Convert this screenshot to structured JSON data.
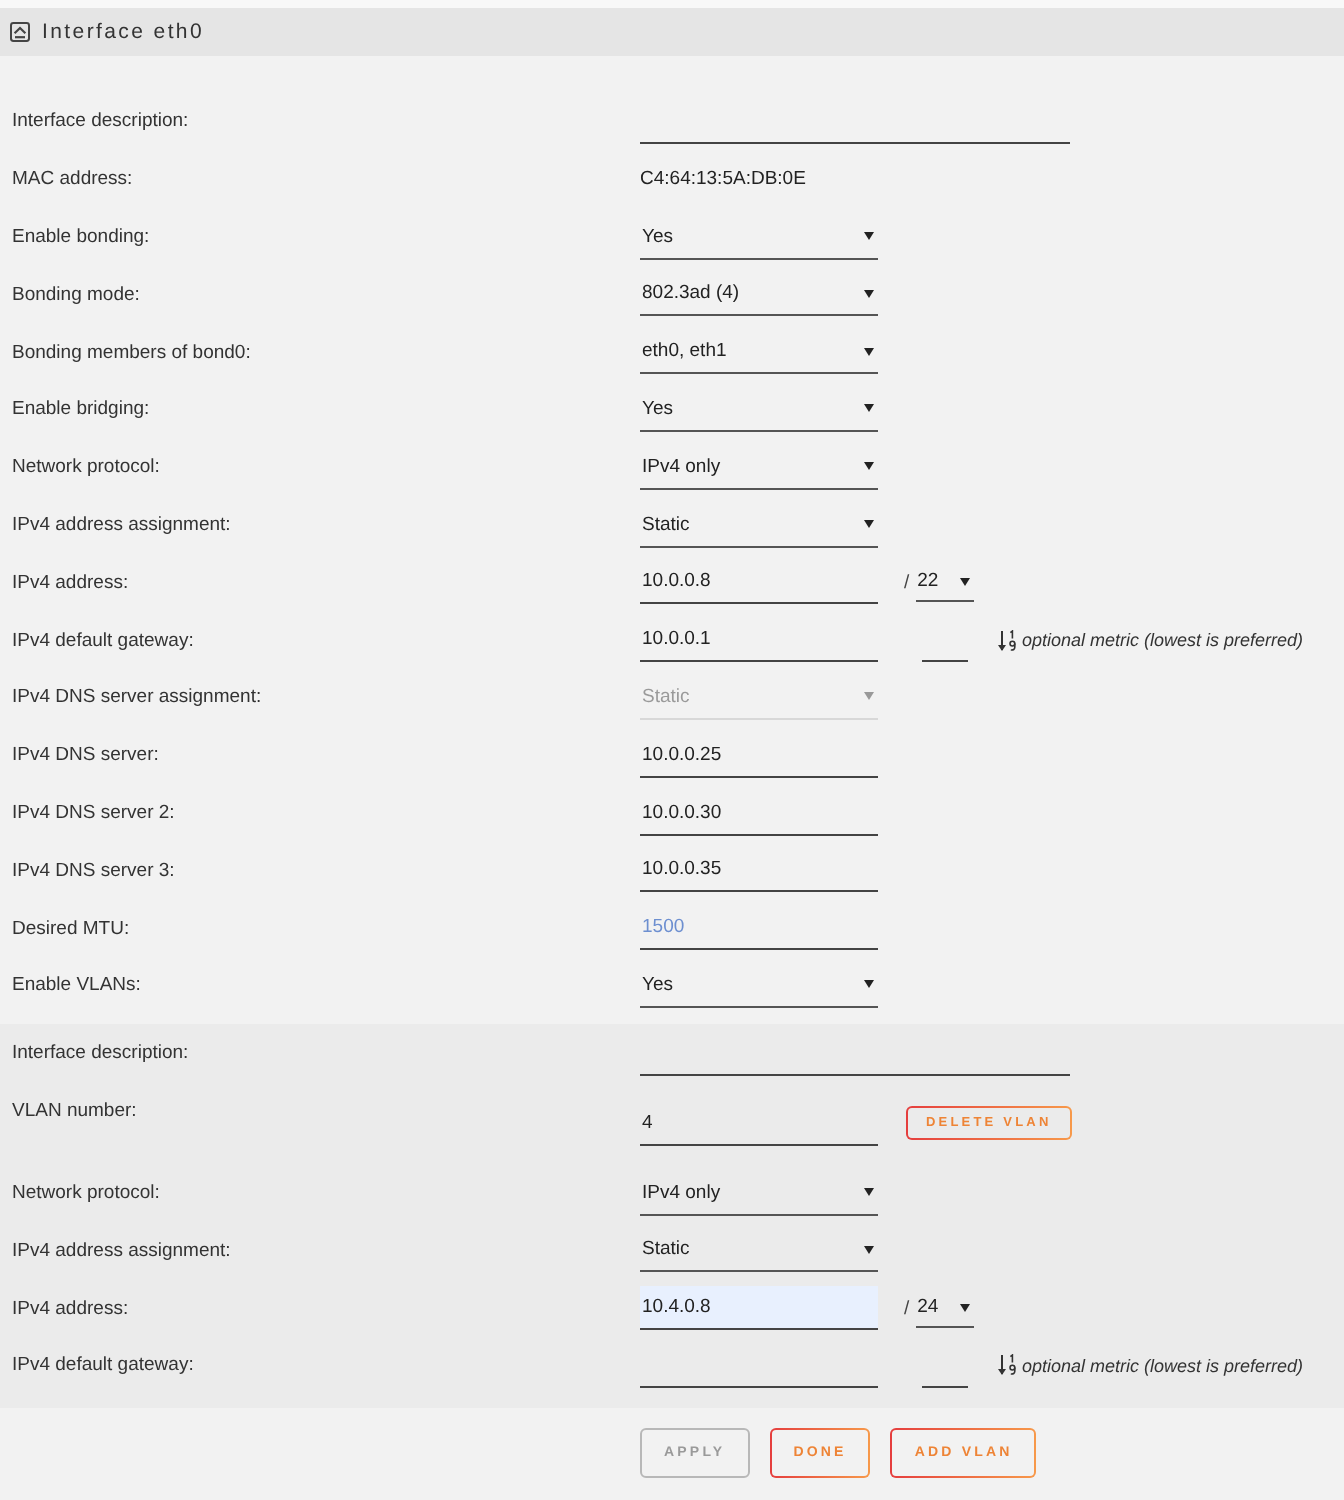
{
  "header": {
    "title": "Interface eth0"
  },
  "fields": [
    {
      "kind": "wide_input",
      "label": "Interface description:",
      "highlighted": false
    },
    {
      "kind": "static",
      "label": "MAC address:",
      "value": "C4:64:13:5A:DB:0E"
    },
    {
      "kind": "select",
      "label": "Enable bonding:",
      "value": "Yes",
      "disabled": false
    },
    {
      "kind": "select",
      "label": "Bonding mode:",
      "value": "802.3ad (4)",
      "disabled": false
    },
    {
      "kind": "select",
      "label": "Bonding members of bond0:",
      "value": "eth0, eth1",
      "disabled": false
    },
    {
      "kind": "select",
      "label": "Enable bridging:",
      "value": "Yes",
      "disabled": false
    },
    {
      "kind": "select",
      "label": "Network protocol:",
      "value": "IPv4 only",
      "disabled": false
    },
    {
      "kind": "select",
      "label": "IPv4 address assignment:",
      "value": "Static",
      "disabled": false
    },
    {
      "kind": "input",
      "label": "IPv4 address:",
      "value": "10.0.0.8",
      "highlighted": false,
      "prefix": {
        "separator": "/",
        "value": "22"
      }
    },
    {
      "kind": "input",
      "label": "IPv4 default gateway:",
      "value": "10.0.0.1",
      "highlighted": false,
      "metric": {
        "hint": "optional metric (lowest is preferred)"
      }
    },
    {
      "kind": "select",
      "label": "IPv4 DNS server assignment:",
      "value": "Static",
      "disabled": true
    },
    {
      "kind": "input",
      "label": "IPv4 DNS server:",
      "value": "10.0.0.25",
      "highlighted": false
    },
    {
      "kind": "input",
      "label": "IPv4 DNS server 2:",
      "value": "10.0.0.30",
      "highlighted": false
    },
    {
      "kind": "input",
      "label": "IPv4 DNS server 3:",
      "value": "10.0.0.35",
      "highlighted": false
    },
    {
      "kind": "input",
      "label": "Desired MTU:",
      "placeholder": "1500",
      "highlighted": false
    },
    {
      "kind": "select",
      "label": "Enable VLANs:",
      "value": "Yes",
      "disabled": false
    }
  ],
  "vlans": [
    {
      "fields": [
        {
          "kind": "wide_input",
          "label": "Interface description:",
          "highlighted": false
        },
        {
          "kind": "input",
          "label": "VLAN number:",
          "value": "4",
          "highlighted": false,
          "button": {
            "label": "DELETE VLAN"
          }
        },
        {
          "kind": "select",
          "label": "Network protocol:",
          "value": "IPv4 only",
          "disabled": false
        },
        {
          "kind": "select",
          "label": "IPv4 address assignment:",
          "value": "Static",
          "disabled": false
        },
        {
          "kind": "input",
          "label": "IPv4 address:",
          "value": "10.4.0.8",
          "highlighted": true,
          "prefix": {
            "separator": "/",
            "value": "24"
          }
        },
        {
          "kind": "input",
          "label": "IPv4 default gateway:",
          "highlighted": false,
          "metric": {
            "hint": "optional metric (lowest is preferred)"
          }
        }
      ]
    }
  ],
  "buttons": [
    {
      "label": "APPLY",
      "disabled": true
    },
    {
      "label": "DONE",
      "disabled": false
    },
    {
      "label": "ADD VLAN",
      "disabled": false
    }
  ]
}
